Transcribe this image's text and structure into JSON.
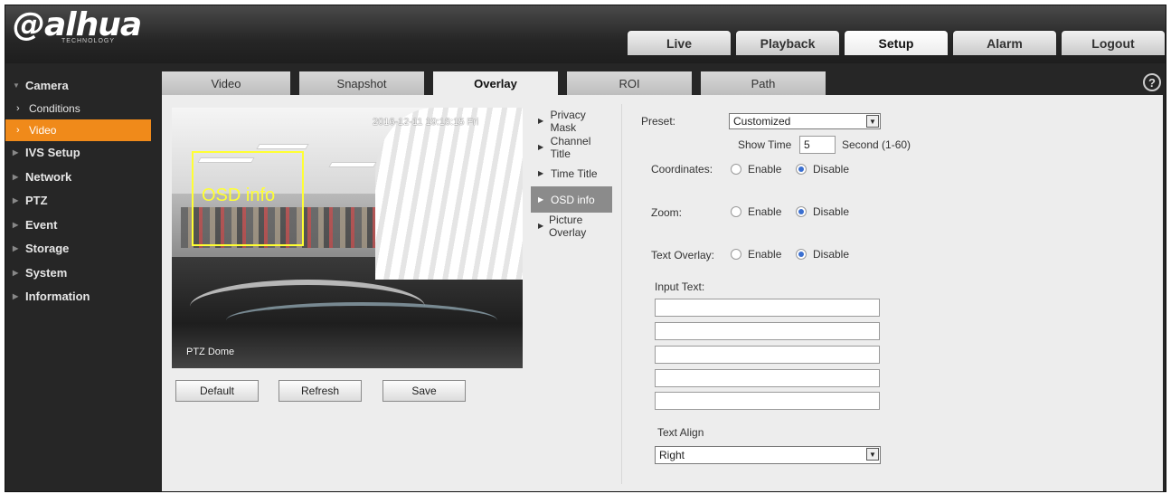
{
  "brand": {
    "name": "alhua",
    "tagline": "TECHNOLOGY"
  },
  "topnav": [
    {
      "label": "Live",
      "active": false
    },
    {
      "label": "Playback",
      "active": false
    },
    {
      "label": "Setup",
      "active": true
    },
    {
      "label": "Alarm",
      "active": false
    },
    {
      "label": "Logout",
      "active": false
    }
  ],
  "sidebar": {
    "camera": "Camera",
    "conditions": "Conditions",
    "video": "Video",
    "ivs_setup": "IVS Setup",
    "network": "Network",
    "ptz": "PTZ",
    "event": "Event",
    "storage": "Storage",
    "system": "System",
    "information": "Information"
  },
  "tabs": [
    "Video",
    "Snapshot",
    "Overlay",
    "ROI",
    "Path"
  ],
  "active_tab": "Overlay",
  "help": "?",
  "preview": {
    "timestamp": "2016-12-11 19:16:15 Fri",
    "osd_label": "OSD info",
    "channel": "PTZ Dome"
  },
  "buttons": {
    "default": "Default",
    "refresh": "Refresh",
    "save": "Save"
  },
  "overlay_menu": [
    "Privacy Mask",
    "Channel Title",
    "Time Title",
    "OSD info",
    "Picture Overlay"
  ],
  "overlay_active": "OSD info",
  "form": {
    "preset_label": "Preset:",
    "preset_value": "Customized",
    "show_time_label": "Show Time",
    "show_time_value": "5",
    "show_time_unit": "Second (1-60)",
    "coordinates_label": "Coordinates:",
    "zoom_label": "Zoom:",
    "text_overlay_label": "Text Overlay:",
    "enable": "Enable",
    "disable": "Disable",
    "input_text_label": "Input Text:",
    "input_lines": [
      "",
      "",
      "",
      "",
      ""
    ],
    "text_align_label": "Text Align",
    "text_align_value": "Right"
  },
  "colors": {
    "accent": "#f08a1a",
    "osd": "#ffff33"
  }
}
